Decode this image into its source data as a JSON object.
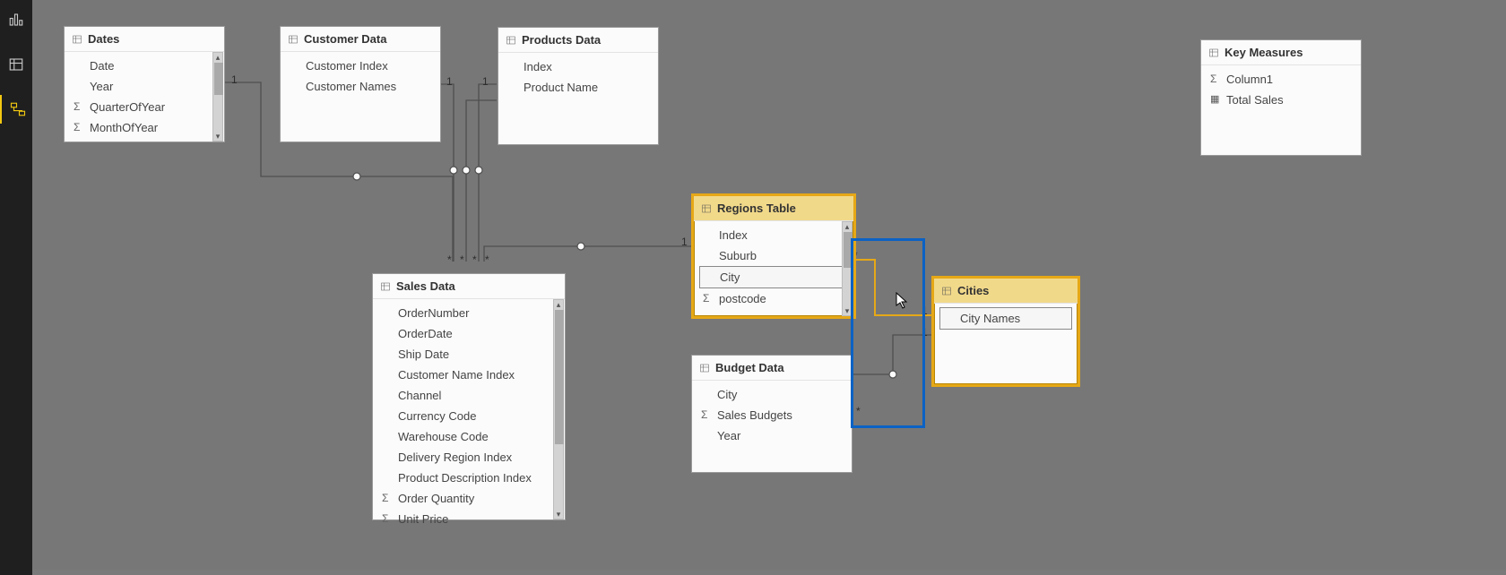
{
  "nav": {
    "report_tip": "Report",
    "data_tip": "Data",
    "model_tip": "Model"
  },
  "tables": {
    "dates": {
      "title": "Dates",
      "f0": "Date",
      "f1": "Year",
      "f2": "QuarterOfYear",
      "f3": "MonthOfYear"
    },
    "customer": {
      "title": "Customer Data",
      "f0": "Customer Index",
      "f1": "Customer Names"
    },
    "products": {
      "title": "Products Data",
      "f0": "Index",
      "f1": "Product Name"
    },
    "keymeasures": {
      "title": "Key Measures",
      "f0": "Column1",
      "f1": "Total Sales"
    },
    "regions": {
      "title": "Regions Table",
      "f0": "Index",
      "f1": "Suburb",
      "f2": "City",
      "f3": "postcode"
    },
    "cities": {
      "title": "Cities",
      "f0": "City Names"
    },
    "budget": {
      "title": "Budget Data",
      "f0": "City",
      "f1": "Sales Budgets",
      "f2": "Year"
    },
    "sales": {
      "title": "Sales Data",
      "f0": "OrderNumber",
      "f1": "OrderDate",
      "f2": "Ship Date",
      "f3": "Customer Name Index",
      "f4": "Channel",
      "f5": "Currency Code",
      "f6": "Warehouse Code",
      "f7": "Delivery Region Index",
      "f8": "Product Description Index",
      "f9": "Order Quantity",
      "f10": "Unit Price"
    }
  },
  "cardinality": {
    "one": "1",
    "many": "*"
  },
  "relationships": [
    {
      "from": "dates",
      "to": "sales",
      "fromCard": "1",
      "toCard": "*"
    },
    {
      "from": "customer",
      "to": "sales",
      "fromCard": "1",
      "toCard": "*"
    },
    {
      "from": "products",
      "to": "sales",
      "fromCard": "1",
      "toCard": "*"
    },
    {
      "from": "products",
      "to": "sales",
      "fromCard": "1",
      "toCard": "*"
    },
    {
      "from": "regions",
      "to": "sales",
      "fromCard": "1",
      "toCard": "*"
    },
    {
      "from": "cities",
      "to": "regions",
      "fromCard": "1",
      "toCard": "*"
    },
    {
      "from": "cities",
      "to": "budget",
      "fromCard": "1",
      "toCard": "*"
    }
  ]
}
